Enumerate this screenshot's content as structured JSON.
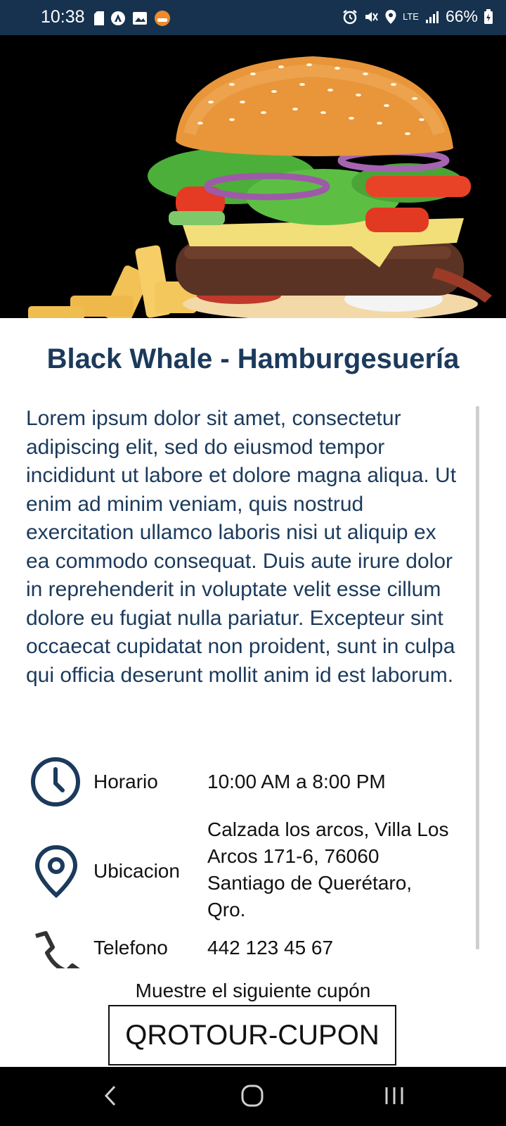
{
  "status_bar": {
    "time": "10:38",
    "battery": "66%",
    "network": "LTE"
  },
  "hero": {
    "image": "burger-with-fries"
  },
  "restaurant": {
    "name": "Black Whale - Hamburgesuería",
    "description": "Lorem ipsum dolor sit amet, consectetur adipiscing elit, sed do eiusmod tempor incididunt ut labore et dolore magna aliqua. Ut enim ad minim veniam, quis nostrud exercitation ullamco laboris nisi ut aliquip ex ea commodo consequat. Duis aute irure dolor in reprehenderit in voluptate velit esse cillum dolore eu fugiat nulla pariatur. Excepteur sint occaecat cupidatat non proident, sunt in culpa qui officia deserunt mollit anim id est laborum."
  },
  "info": {
    "schedule": {
      "icon": "clock-icon",
      "label": "Horario",
      "value": "10:00 AM a 8:00 PM"
    },
    "location": {
      "icon": "location-pin-icon",
      "label": "Ubicacion",
      "value": "Calzada los arcos, Villa Los Arcos 171-6, 76060 Santiago de Querétaro, Qro."
    },
    "phone": {
      "icon": "phone-icon",
      "label": "Telefono",
      "value": "442 123 45 67"
    }
  },
  "coupon": {
    "caption": "Muestre el siguiente cupón",
    "code": "QROTOUR-CUPON"
  },
  "colors": {
    "primary": "#1b3a5c",
    "status_bar": "#16324f"
  }
}
